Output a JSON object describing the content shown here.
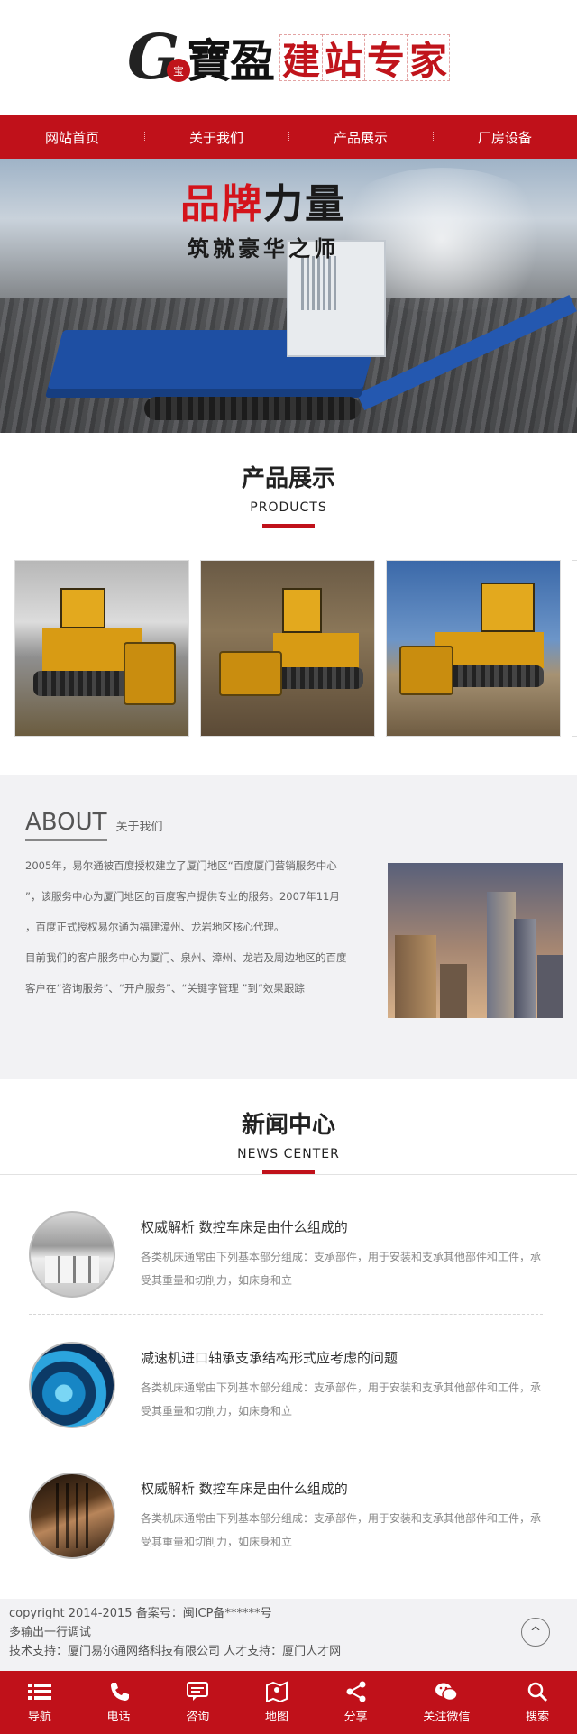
{
  "header": {
    "logo_letter": "G",
    "logo_seal": "宝",
    "logo_name": "寶盈",
    "slogan": [
      "建",
      "站",
      "专",
      "家"
    ]
  },
  "nav": [
    "网站首页",
    "关于我们",
    "产品展示",
    "厂房设备"
  ],
  "banner": {
    "title_red": "品牌",
    "title_dark": "力量",
    "subtitle": "筑就豪华之师"
  },
  "products_section": {
    "title": "产品展示",
    "subtitle": "PRODUCTS"
  },
  "about": {
    "title_en": "ABOUT",
    "title_cn": "关于我们",
    "lines": [
      "2005年，易尔通被百度授权建立了厦门地区“百度厦门营销服务中心",
      "”，该服务中心为厦门地区的百度客户提供专业的服务。2007年11月",
      "，百度正式授权易尔通为福建漳州、龙岩地区核心代理。",
      "目前我们的客户服务中心为厦门、泉州、漳州、龙岩及周边地区的百度",
      "客户在“咨询服务”、“开户服务”、“关键字管理 ”到“效果跟踪"
    ]
  },
  "news_section": {
    "title": "新闻中心",
    "subtitle": "NEWS CENTER",
    "items": [
      {
        "title": "权威解析 数控车床是由什么组成的",
        "desc": "各类机床通常由下列基本部分组成：支承部件，用于安装和支承其他部件和工件，承受其重量和切削力，如床身和立"
      },
      {
        "title": "减速机进口轴承支承结构形式应考虑的问题",
        "desc": "各类机床通常由下列基本部分组成：支承部件，用于安装和支承其他部件和工件，承受其重量和切削力，如床身和立"
      },
      {
        "title": "权威解析 数控车床是由什么组成的",
        "desc": "各类机床通常由下列基本部分组成：支承部件，用于安装和支承其他部件和工件，承受其重量和切削力，如床身和立"
      }
    ]
  },
  "footer": {
    "copyright": "copyright 2014-2015 备案号：闽ICP备******号",
    "line2": "多输出一行调试",
    "support": "技术支持：厦门易尔通网络科技有限公司 人才支持：厦门人才网",
    "totop": "^"
  },
  "bottombar": [
    {
      "label": "导航",
      "icon": "menu-icon"
    },
    {
      "label": "电话",
      "icon": "phone-icon"
    },
    {
      "label": "咨询",
      "icon": "chat-icon"
    },
    {
      "label": "地图",
      "icon": "map-icon"
    },
    {
      "label": "分享",
      "icon": "share-icon"
    },
    {
      "label": "关注微信",
      "icon": "wechat-icon"
    },
    {
      "label": "搜索",
      "icon": "search-icon"
    }
  ],
  "colors": {
    "brand_red": "#c0111a",
    "footer_bg": "#f2f2f4"
  }
}
